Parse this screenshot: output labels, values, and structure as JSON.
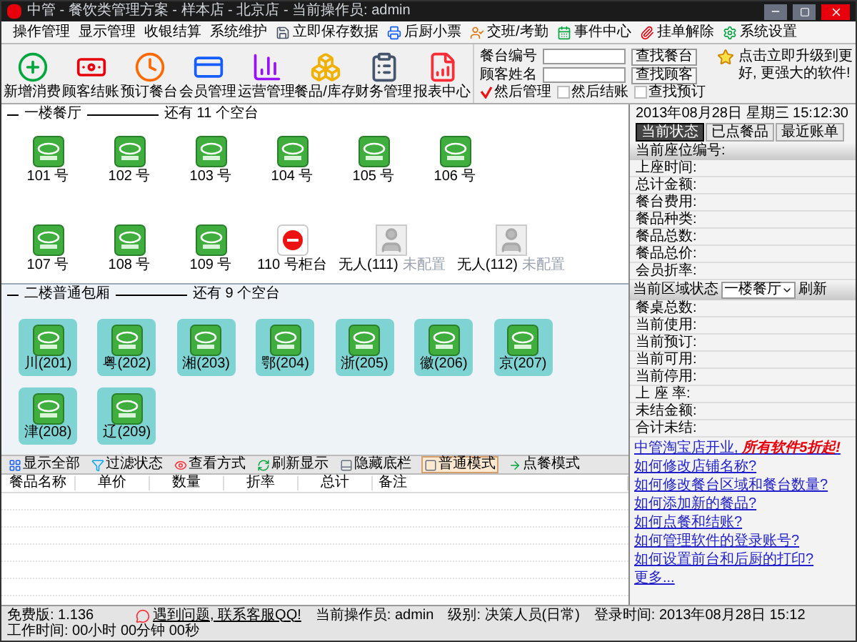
{
  "window": {
    "title": "中管 - 餐饮类管理方案 - 样本店 - 北京店 - 当前操作员: admin"
  },
  "menu": [
    {
      "label": "操作管理",
      "kind": "menu"
    },
    {
      "label": "显示管理",
      "kind": "menu"
    },
    {
      "label": "收银结算",
      "kind": "menu"
    },
    {
      "label": "系统维护",
      "kind": "menu"
    },
    {
      "label": "立即保存数据",
      "kind": "tool"
    },
    {
      "label": "后厨小票",
      "kind": "tool"
    },
    {
      "label": "交班/考勤",
      "kind": "tool"
    },
    {
      "label": "事件中心",
      "kind": "tool"
    },
    {
      "label": "挂单解除",
      "kind": "tool"
    },
    {
      "label": "系统设置",
      "kind": "tool"
    }
  ],
  "banner": "点击立即升级到更好, 更强大的软件!",
  "toolbar": [
    {
      "label": "新增消费"
    },
    {
      "label": "顾客结账"
    },
    {
      "label": "预订餐台"
    },
    {
      "label": "会员管理"
    },
    {
      "label": "运营管理"
    },
    {
      "label": "餐品/库存"
    },
    {
      "label": "财务管理"
    },
    {
      "label": "报表中心"
    }
  ],
  "search": {
    "fields": [
      {
        "label": "餐台编号",
        "button": "查找餐台"
      },
      {
        "label": "顾客姓名",
        "button": "查找顾客"
      }
    ],
    "options": [
      {
        "label": "然后管理",
        "checked": true
      },
      {
        "label": "然后结账",
        "checked": false
      },
      {
        "label": "查找预订",
        "checked": false
      }
    ]
  },
  "datetime": "2013年08月28日 星期三 15:12:30",
  "tabs": [
    {
      "label": "当前状态",
      "selected": true
    },
    {
      "label": "已点餐品",
      "selected": false
    },
    {
      "label": "最近账单",
      "selected": false
    }
  ],
  "seat_panel": {
    "title": "当前座位编号:",
    "rows": [
      "上座时间:",
      "总计金额:",
      "餐台费用:",
      "餐品种类:",
      "餐品总数:",
      "餐品总价:",
      "会员折率:"
    ]
  },
  "area_panel": {
    "title": "当前区域状态",
    "select": "一楼餐厅",
    "button": "刷新",
    "rows": [
      "餐桌总数:",
      "当前使用:",
      "当前预订:",
      "当前可用:",
      "当前停用:",
      "上 座 率:",
      "未结金额:",
      "合计未结:"
    ]
  },
  "links": [
    {
      "text": "中管淘宝店开业, **所有软件5折起!**",
      "kind": "promo"
    },
    {
      "text": "如何修改店铺名称?",
      "kind": "help"
    },
    {
      "text": "如何修改餐台区域和餐台数量?",
      "kind": "help"
    },
    {
      "text": "如何添加新的餐品?",
      "kind": "help"
    },
    {
      "text": "如何点餐和结账?",
      "kind": "help"
    },
    {
      "text": "如何管理软件的登录账号?",
      "kind": "help"
    },
    {
      "text": "如何设置前台和后厨的打印?",
      "kind": "help"
    },
    {
      "text": "更多...",
      "kind": "help"
    }
  ],
  "areas": [
    {
      "name": "一楼餐厅",
      "free": "还有 11 个空台",
      "kind": "hall",
      "tables": [
        {
          "label": "101 号",
          "kind": "free"
        },
        {
          "label": "102 号",
          "kind": "free"
        },
        {
          "label": "103 号",
          "kind": "free"
        },
        {
          "label": "104 号",
          "kind": "free"
        },
        {
          "label": "105 号",
          "kind": "free"
        },
        {
          "label": "106 号",
          "kind": "free"
        },
        {
          "label": "107 号",
          "kind": "free"
        },
        {
          "label": "108 号",
          "kind": "free"
        },
        {
          "label": "109 号",
          "kind": "free"
        },
        {
          "label": "110 号柜台",
          "kind": "counter"
        },
        {
          "label": "无人(111)",
          "note": "未配置",
          "kind": "unset"
        },
        {
          "label": "无人(112)",
          "note": "未配置",
          "kind": "unset"
        }
      ]
    },
    {
      "name": "二楼普通包厢",
      "free": "还有 9 个空台",
      "kind": "room",
      "tables": [
        {
          "label": "川(201)",
          "kind": "free"
        },
        {
          "label": "粤(202)",
          "kind": "free"
        },
        {
          "label": "湘(203)",
          "kind": "free"
        },
        {
          "label": "鄂(204)",
          "kind": "free"
        },
        {
          "label": "浙(205)",
          "kind": "free"
        },
        {
          "label": "徽(206)",
          "kind": "free"
        },
        {
          "label": "京(207)",
          "kind": "free"
        },
        {
          "label": "津(208)",
          "kind": "free"
        },
        {
          "label": "辽(209)",
          "kind": "free"
        }
      ]
    }
  ],
  "view_bar": [
    {
      "label": "显示全部",
      "selected": false
    },
    {
      "label": "过滤状态",
      "selected": false
    },
    {
      "label": "查看方式",
      "selected": false
    },
    {
      "label": "刷新显示",
      "selected": false
    },
    {
      "label": "隐藏底栏",
      "selected": false
    },
    {
      "label": "普通模式",
      "selected": true
    },
    {
      "label": "点餐模式",
      "selected": false
    }
  ],
  "order_table": {
    "columns": [
      "餐品名称",
      "单价",
      "数量",
      "折率",
      "总计",
      "备注"
    ]
  },
  "status_bar": {
    "version": "免费版: 1.136",
    "support": "遇到问题, 联系客服QQ!",
    "operator": "当前操作员: admin",
    "level": "级别: 决策人员(日常)",
    "login": "登录时间: 2013年08月28日 15:12",
    "worktime": "工作时间: 00小时 00分钟 00秒"
  }
}
